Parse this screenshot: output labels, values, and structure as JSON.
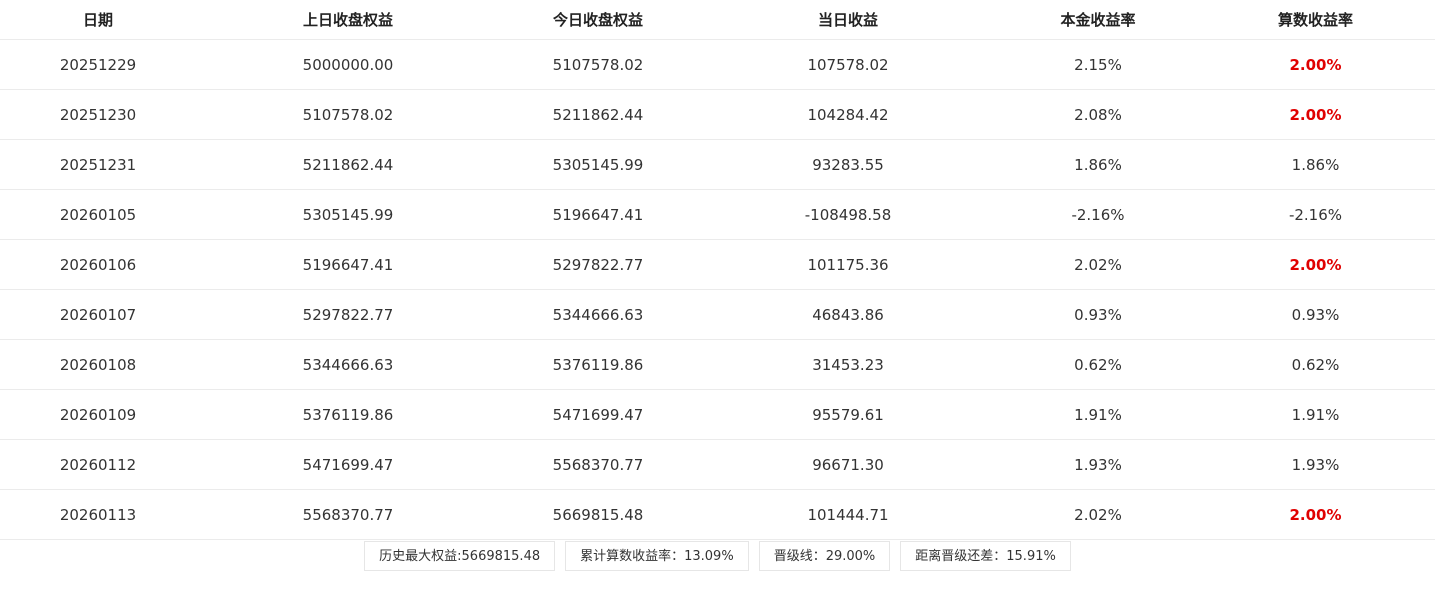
{
  "table": {
    "headers": [
      "日期",
      "上日收盘权益",
      "今日收盘权益",
      "当日收益",
      "本金收益率",
      "算数收益率"
    ],
    "rows": [
      [
        "20251229",
        "5000000.00",
        "5107578.02",
        "107578.02",
        "2.15%",
        "2.00%"
      ],
      [
        "20251230",
        "5107578.02",
        "5211862.44",
        "104284.42",
        "2.08%",
        "2.00%"
      ],
      [
        "20251231",
        "5211862.44",
        "5305145.99",
        "93283.55",
        "1.86%",
        "1.86%"
      ],
      [
        "20260105",
        "5305145.99",
        "5196647.41",
        "-108498.58",
        "-2.16%",
        "-2.16%"
      ],
      [
        "20260106",
        "5196647.41",
        "5297822.77",
        "101175.36",
        "2.02%",
        "2.00%"
      ],
      [
        "20260107",
        "5297822.77",
        "5344666.63",
        "46843.86",
        "0.93%",
        "0.93%"
      ],
      [
        "20260108",
        "5344666.63",
        "5376119.86",
        "31453.23",
        "0.62%",
        "0.62%"
      ],
      [
        "20260109",
        "5376119.86",
        "5471699.47",
        "95579.61",
        "1.91%",
        "1.91%"
      ],
      [
        "20260112",
        "5471699.47",
        "5568370.77",
        "96671.30",
        "1.93%",
        "1.93%"
      ],
      [
        "20260113",
        "5568370.77",
        "5669815.48",
        "101444.71",
        "2.02%",
        "2.00%"
      ]
    ],
    "capped_rows": [
      0,
      1,
      4,
      9
    ]
  },
  "summary": {
    "max_equity": "历史最大权益:5669815.48",
    "cumulative_return": "累计算数收益率：13.09%",
    "promotion_line": "晋级线：29.00%",
    "gap_to_promotion": "距离晋级还差：15.91%"
  },
  "colors": {
    "highlight": "#e00000",
    "border": "#ebebeb"
  }
}
